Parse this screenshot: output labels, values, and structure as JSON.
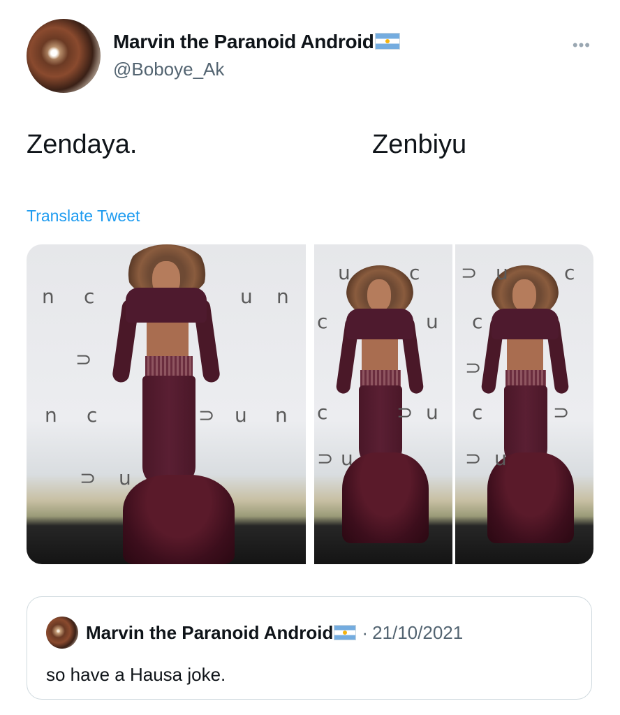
{
  "author": {
    "display_name": "Marvin the Paranoid Android",
    "handle": "@Boboye_Ak",
    "flag_icon": "argentina-flag-icon"
  },
  "more_icon": "•••",
  "tweet": {
    "text_left": "Zendaya.",
    "text_right": "Zenbiyu",
    "translate_label": "Translate Tweet"
  },
  "media": {
    "panels": [
      {
        "letters": [
          "n",
          "c",
          "u",
          "n",
          "⊃",
          "n",
          "c",
          "⊃",
          "u",
          "n",
          "⊃",
          "u"
        ]
      },
      {
        "letters": [
          "u",
          "c",
          "c",
          "u",
          "c",
          "⊃",
          "u",
          "⊃",
          "u"
        ]
      },
      {
        "letters": [
          "⊃",
          "u",
          "c",
          "c",
          "⊃",
          "c",
          "⊃",
          "⊃",
          "u"
        ]
      }
    ]
  },
  "quoted": {
    "display_name": "Marvin the Paranoid Android",
    "separator": "·",
    "date": "21/10/2021",
    "text": "so have a Hausa joke."
  },
  "colors": {
    "link": "#1d9bf0",
    "secondary_text": "#536471",
    "border": "#cfd9de"
  }
}
